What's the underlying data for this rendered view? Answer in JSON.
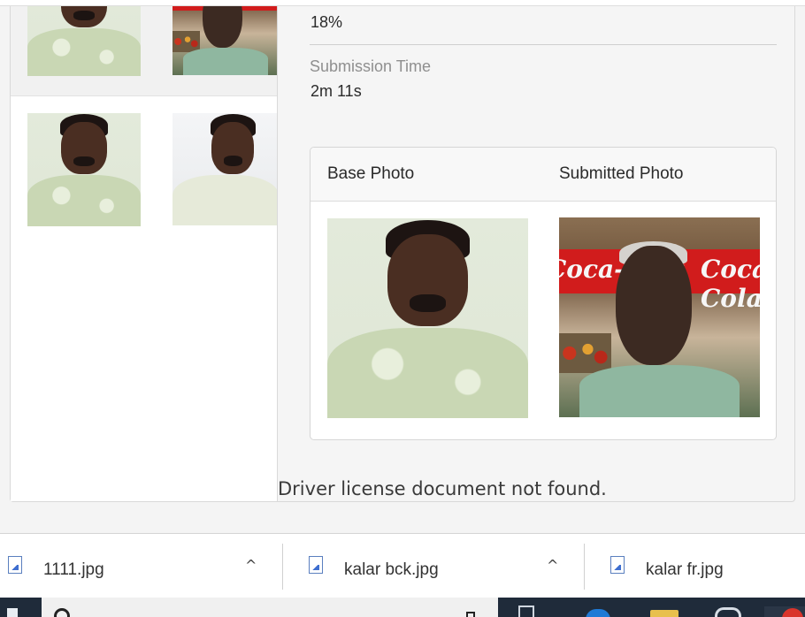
{
  "verification": {
    "percent_value": "18%",
    "submission_time_label": "Submission Time",
    "submission_time_value": "2m 11s",
    "comparison": {
      "base_photo_label": "Base Photo",
      "submitted_photo_label": "Submitted Photo",
      "submitted_banner_text": "Coca-Cola"
    },
    "license_message": "Driver license document not found."
  },
  "downloads": [
    {
      "file": "1111.jpg",
      "chevron": "^"
    },
    {
      "file": "kalar bck.jpg",
      "chevron": "^"
    },
    {
      "file": "kalar fr.jpg"
    }
  ],
  "colors": {
    "banner_red": "#d11c1c",
    "taskbar": "#1f2b3a",
    "file_icon_blue": "#3f6fd0"
  }
}
